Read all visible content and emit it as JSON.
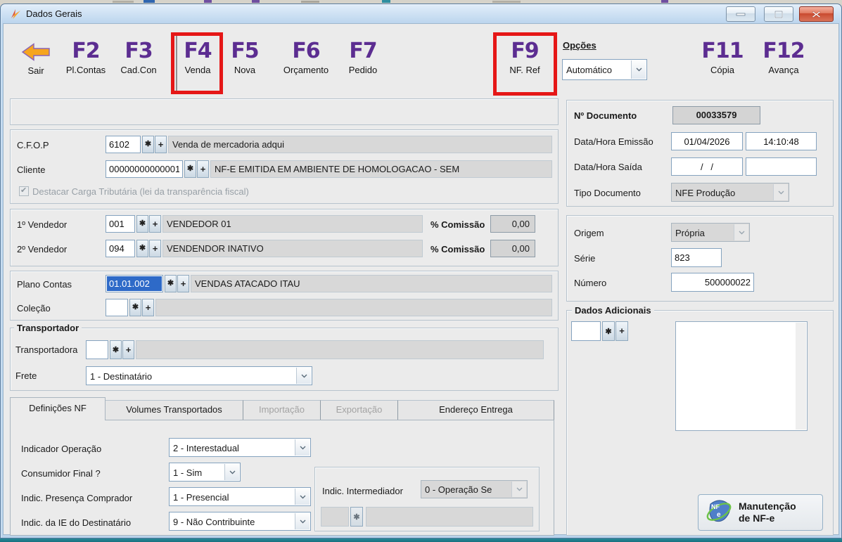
{
  "window": {
    "title": "Dados Gerais"
  },
  "toolbar": {
    "sair_label": "Sair",
    "fkeys": [
      {
        "key": "F2",
        "label": "Pl.Contas"
      },
      {
        "key": "F3",
        "label": "Cad.Con"
      },
      {
        "key": "F4",
        "label": "Venda"
      },
      {
        "key": "F5",
        "label": "Nova"
      },
      {
        "key": "F6",
        "label": "Orçamento"
      },
      {
        "key": "F7",
        "label": "Pedido"
      },
      {
        "key": "F9",
        "label": "NF. Ref"
      },
      {
        "key": "F11",
        "label": "Cópia"
      },
      {
        "key": "F12",
        "label": "Avança"
      }
    ],
    "opcoes": {
      "label": "Opções",
      "value": "Automático"
    }
  },
  "lookup": {
    "star": "✱",
    "plus": "+"
  },
  "form": {
    "cfop": {
      "label": "C.F.O.P",
      "code": "6102",
      "desc": "Venda de mercadoria adqui"
    },
    "cliente": {
      "label": "Cliente",
      "code": "00000000000001",
      "desc": "NF-E EMITIDA EM AMBIENTE DE HOMOLOGACAO - SEM"
    },
    "destacar_label": "Destacar Carga Tributária (lei da transparência fiscal)",
    "vendedor1": {
      "label": "1º Vendedor",
      "code": "001",
      "desc": "VENDEDOR 01",
      "comissao_label": "% Comissão",
      "comissao": "0,00"
    },
    "vendedor2": {
      "label": "2º Vendedor",
      "code": "094",
      "desc": "VENDENDOR INATIVO",
      "comissao_label": "% Comissão",
      "comissao": "0,00"
    },
    "plano_contas": {
      "label": "Plano Contas",
      "code": "01.01.002",
      "desc": "VENDAS ATACADO ITAU"
    },
    "colecao": {
      "label": "Coleção",
      "code": "",
      "desc": ""
    },
    "transportador": {
      "legend": "Transportador",
      "transportadora_label": "Transportadora",
      "transportadora_code": "",
      "transportadora_desc": "",
      "frete_label": "Frete",
      "frete_value": "1 - Destinatário"
    }
  },
  "tabs": {
    "items": [
      {
        "label": "Definições NF"
      },
      {
        "label": "Volumes Transportados"
      },
      {
        "label": "Importação"
      },
      {
        "label": "Exportação"
      },
      {
        "label": "Endereço Entrega"
      }
    ]
  },
  "definicoes": {
    "indicador_operacao": {
      "label": "Indicador Operação",
      "value": "2 - Interestadual"
    },
    "consumidor_final": {
      "label": "Consumidor Final ?",
      "value": "1 - Sim"
    },
    "indic_presenca": {
      "label": "Indic. Presença Comprador",
      "value": "1 - Presencial"
    },
    "indic_ie": {
      "label": "Indic. da IE do Destinatário",
      "value": "9 - Não Contribuinte"
    },
    "indic_intermediador": {
      "label": "Indic. Intermediador",
      "value": "0 - Operação Se"
    }
  },
  "documento": {
    "numero_doc": {
      "label": "Nº Documento",
      "value": "00033579"
    },
    "emissao": {
      "label": "Data/Hora Emissão",
      "date": "01/04/2026",
      "time": "14:10:48"
    },
    "saida": {
      "label": "Data/Hora Saída",
      "date": "/   /",
      "time": ""
    },
    "tipo": {
      "label": "Tipo Documento",
      "value": "NFE Produção"
    },
    "origem": {
      "label": "Origem",
      "value": "Própria"
    },
    "serie": {
      "label": "Série",
      "value": "823"
    },
    "numero": {
      "label": "Número",
      "value": "500000022"
    }
  },
  "dados_adicionais": {
    "legend": "Dados Adicionais",
    "code": "",
    "text": ""
  },
  "manutencao": {
    "line1": "Manutenção",
    "line2": "de NF-e"
  },
  "colors": {
    "fkey_purple": "#5c2d91",
    "annotation_red": "#e51717",
    "selection_blue": "#2e6ac8",
    "close_red": "#c94a2f"
  }
}
